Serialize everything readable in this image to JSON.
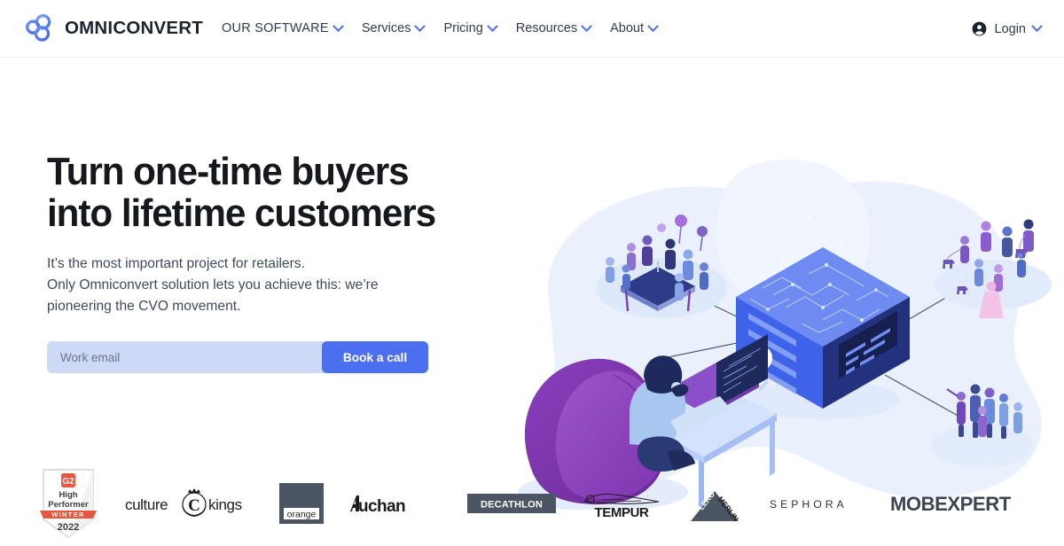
{
  "nav": {
    "brand_name": "OMNICONVERT",
    "brand_logo_icon": "omniconvert-trefoil-logo",
    "items": [
      {
        "label": "OUR SOFTWARE",
        "caps": true,
        "caret": "chevron-down-icon"
      },
      {
        "label": "Services",
        "caps": false,
        "caret": "chevron-down-icon"
      },
      {
        "label": "Pricing",
        "caps": false,
        "caret": "chevron-down-icon"
      },
      {
        "label": "Resources",
        "caps": false,
        "caret": "chevron-down-icon"
      },
      {
        "label": "About",
        "caps": false,
        "caret": "chevron-down-icon"
      }
    ],
    "login": {
      "label": "Login",
      "icon": "account-circle-icon",
      "caret": "chevron-down-icon"
    }
  },
  "hero": {
    "headline_line1": "Turn one-time buyers",
    "headline_line2": "into lifetime customers",
    "sub_line1": "It’s the most important project for retailers.",
    "sub_line2": "Only Omniconvert solution lets you achieve this: we’re",
    "sub_line3": "pioneering the CVO movement.",
    "email_placeholder": "Work email",
    "email_value": "",
    "cta_label": "Book a call",
    "illustration_name": "isometric-cvo-network-illustration"
  },
  "logos": {
    "items": [
      {
        "name": "g2-high-performer-badge",
        "text_top": "High",
        "text_mid": "Performer",
        "ribbon": "WINTER",
        "year": "2022",
        "mark": "G2"
      },
      {
        "name": "culture-kings-logo",
        "text": "culture kings"
      },
      {
        "name": "orange-logo",
        "text": "orange"
      },
      {
        "name": "auchan-logo",
        "text": "Auchan"
      },
      {
        "name": "decathlon-logo",
        "text": "DECATHLON"
      },
      {
        "name": "tempur-logo",
        "text": "TEMPUR"
      },
      {
        "name": "leroy-merlin-logo",
        "text_a": "LEROY",
        "text_b": "MERLIN"
      },
      {
        "name": "sephora-logo",
        "text": "SEPHORA"
      },
      {
        "name": "mobexpert-logo",
        "text": "MOBEXPERT"
      }
    ]
  },
  "colors": {
    "accent_blue": "#4c6fef",
    "input_bg": "#ccd9f7",
    "headline": "#16181d",
    "body_text": "#3e4a5c",
    "logo_gray": "#4b5563",
    "g2_orange": "#e8563f",
    "blob_bg": "#eaf0fd",
    "cube_blue": "#4a67e8",
    "beanbag_purple": "#7b35ad"
  }
}
